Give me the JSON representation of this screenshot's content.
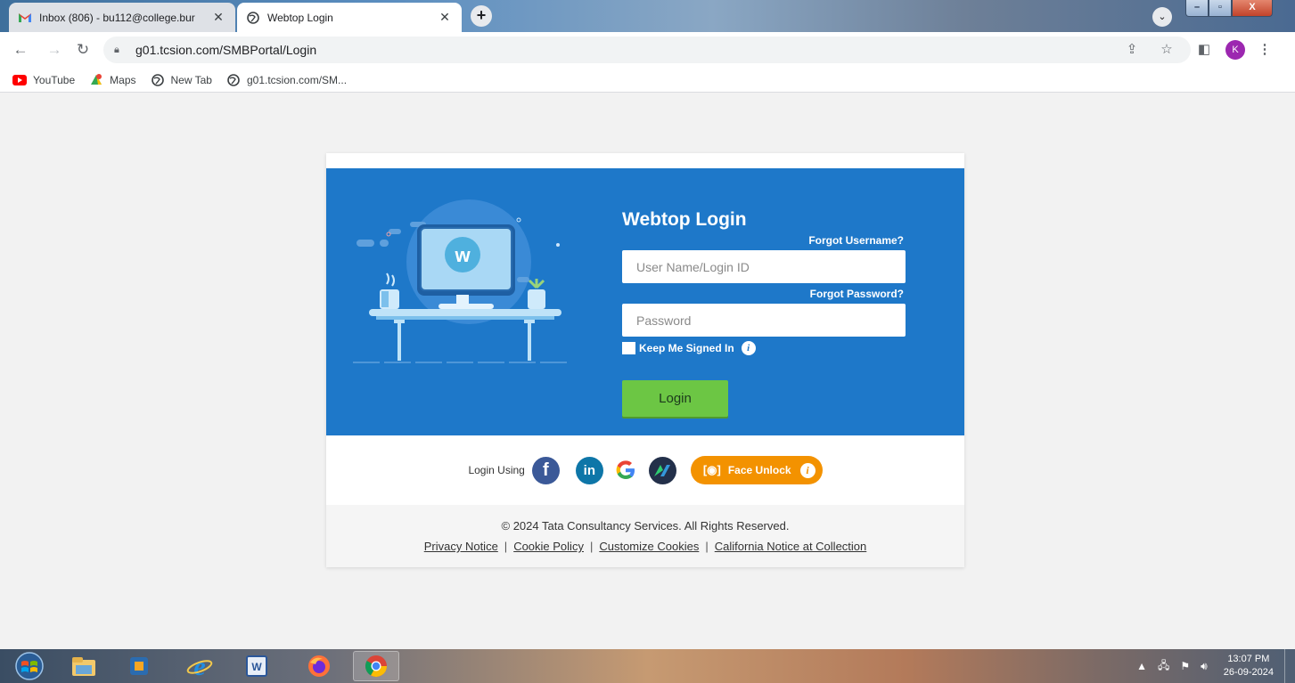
{
  "browser": {
    "tabs": [
      {
        "title": "Inbox (806) - bu112@college.bur",
        "icon": "gmail-icon"
      },
      {
        "title": "Webtop Login",
        "icon": "globe-icon"
      }
    ],
    "url": "g01.tcsion.com/SMBPortal/Login",
    "profile_initial": "K",
    "bookmarks": [
      {
        "label": "YouTube",
        "icon": "youtube-icon"
      },
      {
        "label": "Maps",
        "icon": "maps-icon"
      },
      {
        "label": "New Tab",
        "icon": "globe-icon"
      },
      {
        "label": "g01.tcsion.com/SM...",
        "icon": "globe-icon"
      }
    ]
  },
  "login": {
    "title": "Webtop Login",
    "forgot_username": "Forgot Username?",
    "forgot_password": "Forgot Password?",
    "username_placeholder": "User Name/Login ID",
    "password_placeholder": "Password",
    "keep_signed_in": "Keep Me Signed In",
    "login_button": "Login"
  },
  "social": {
    "label": "Login Using",
    "providers": [
      "facebook",
      "linkedin",
      "google",
      "webtop"
    ],
    "face_unlock": "Face Unlock"
  },
  "footer": {
    "copyright": "© 2024 Tata Consultancy Services. All Rights Reserved.",
    "links": [
      "Privacy Notice",
      "Cookie Policy",
      "Customize Cookies",
      "California Notice at Collection"
    ]
  },
  "taskbar": {
    "time": "13:07 PM",
    "date": "26-09-2024"
  },
  "colors": {
    "brand_blue": "#1e78c9",
    "login_green": "#6cc644",
    "face_unlock_orange": "#f39200"
  }
}
